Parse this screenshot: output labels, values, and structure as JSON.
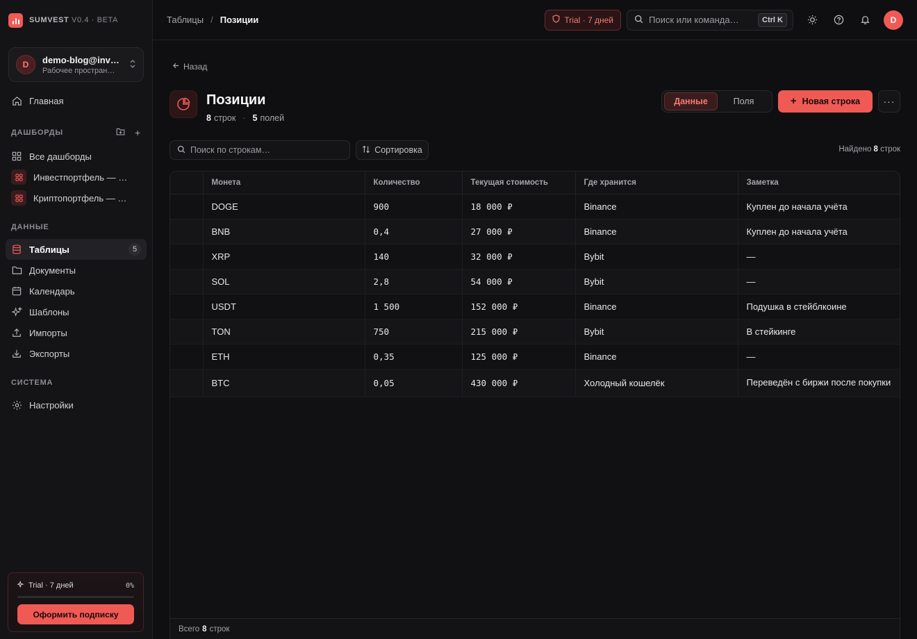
{
  "brand": {
    "name": "SUMVEST",
    "version": "V0.4 · BETA"
  },
  "workspace": {
    "avatar": "D",
    "name": "demo-blog@inv…",
    "subtitle": "Рабочее простран…"
  },
  "nav": {
    "home": "Главная",
    "dashboards_title": "ДАШБОРДЫ",
    "all_dashboards": "Все дашборды",
    "dashboards": [
      "Инвестпортфель — …",
      "Криптопортфель — …"
    ],
    "data_title": "ДАННЫЕ",
    "data_items": [
      {
        "label": "Таблицы",
        "badge": "5"
      },
      {
        "label": "Документы"
      },
      {
        "label": "Календарь"
      },
      {
        "label": "Шаблоны"
      },
      {
        "label": "Импорты"
      },
      {
        "label": "Экспорты"
      }
    ],
    "system_title": "СИСТЕМА",
    "settings": "Настройки"
  },
  "trial_card": {
    "label": "Trial · 7 дней",
    "percent": "0%",
    "progress": 0,
    "button": "Оформить подписку"
  },
  "topbar": {
    "breadcrumb_parent": "Таблицы",
    "breadcrumb_sep": "/",
    "breadcrumb_current": "Позиции",
    "trial_pill": "Trial · 7 дней",
    "search_placeholder": "Поиск или команда…",
    "shortcut": "Ctrl K",
    "user_avatar": "D"
  },
  "page": {
    "back": "Назад",
    "title": "Позиции",
    "rows_count": "8",
    "rows_label": "строк",
    "fields_count": "5",
    "fields_label": "полей",
    "tab_data": "Данные",
    "tab_fields": "Поля",
    "new_row": "Новая строка",
    "row_search_placeholder": "Поиск по строкам…",
    "sort": "Сортировка",
    "found_label": "Найдено",
    "found_count": "8",
    "found_suffix": "строк",
    "total_label": "Всего",
    "total_count": "8",
    "total_suffix": "строк"
  },
  "table": {
    "columns": [
      "Монета",
      "Количество",
      "Текущая стоимость",
      "Где хранится",
      "Заметка"
    ],
    "rows": [
      [
        "DOGE",
        "900",
        "18 000 ₽",
        "Binance",
        "Куплен до начала учёта"
      ],
      [
        "BNB",
        "0,4",
        "27 000 ₽",
        "Binance",
        "Куплен до начала учёта"
      ],
      [
        "XRP",
        "140",
        "32 000 ₽",
        "Bybit",
        "—"
      ],
      [
        "SOL",
        "2,8",
        "54 000 ₽",
        "Bybit",
        "—"
      ],
      [
        "USDT",
        "1 500",
        "152 000 ₽",
        "Binance",
        "Подушка в стейблкоине"
      ],
      [
        "TON",
        "750",
        "215 000 ₽",
        "Bybit",
        "В стейкинге"
      ],
      [
        "ETH",
        "0,35",
        "125 000 ₽",
        "Binance",
        "—"
      ],
      [
        "BTC",
        "0,05",
        "430 000 ₽",
        "Холодный кошелёк",
        "Переведён с биржи после покупки"
      ]
    ]
  },
  "colors": {
    "accent": "#f05a55",
    "background": "#0f0f11",
    "sidebar": "#141416"
  }
}
